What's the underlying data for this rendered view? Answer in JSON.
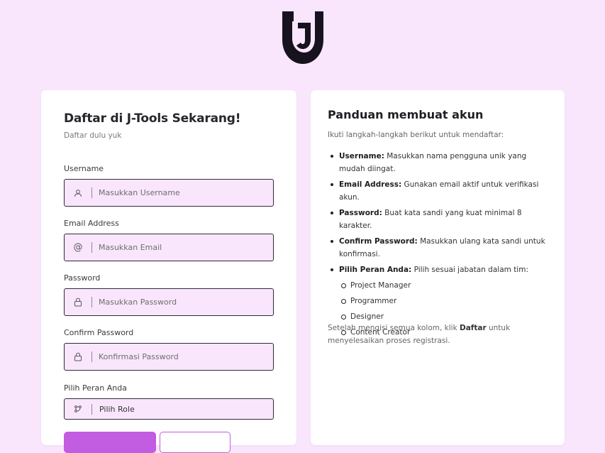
{
  "form": {
    "title": "Daftar di J-Tools Sekarang!",
    "subtitle": "Daftar dulu yuk",
    "fields": [
      {
        "label": "Username",
        "placeholder": "Masukkan Username",
        "icon": "user-icon"
      },
      {
        "label": "Email Address",
        "placeholder": "Masukkan Email",
        "icon": "at-icon"
      },
      {
        "label": "Password",
        "placeholder": "Masukkan Password",
        "icon": "lock-icon"
      },
      {
        "label": "Confirm Password",
        "placeholder": "Konfirmasi Password",
        "icon": "lock-icon"
      }
    ],
    "role": {
      "label": "Pilih Peran Anda",
      "selected": "Pilih Role",
      "icon": "roles-icon"
    }
  },
  "guide": {
    "title": "Panduan membuat akun",
    "intro": "Ikuti langkah-langkah berikut untuk mendaftar:",
    "steps": [
      {
        "term": "Username:",
        "text": " Masukkan nama pengguna unik yang mudah diingat."
      },
      {
        "term": "Email Address:",
        "text": " Gunakan email aktif untuk verifikasi akun."
      },
      {
        "term": "Password:",
        "text": " Buat kata sandi yang kuat minimal 8 karakter."
      },
      {
        "term": "Confirm Password:",
        "text": " Masukkan ulang kata sandi untuk konfirmasi."
      },
      {
        "term": "Pilih Peran Anda:",
        "text": " Pilih sesuai jabatan dalam tim:"
      }
    ],
    "roles": [
      "Project Manager",
      "Programmer",
      "Designer",
      "Content Creator"
    ],
    "footer_pre": "Setelah mengisi semua kolom, klik ",
    "footer_bold": "Daftar",
    "footer_post": " untuk menyelesaikan proses registrasi."
  },
  "colors": {
    "background": "#f9e6fd",
    "accent": "#c25ce0",
    "field_border": "#2e2a38"
  }
}
